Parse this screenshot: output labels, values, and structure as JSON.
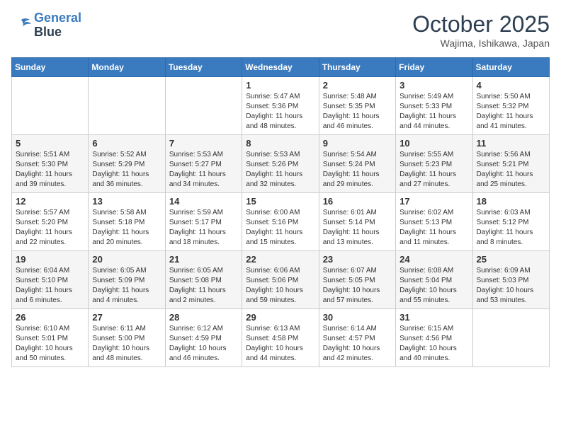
{
  "header": {
    "logo_line1": "General",
    "logo_line2": "Blue",
    "month_title": "October 2025",
    "location": "Wajima, Ishikawa, Japan"
  },
  "weekdays": [
    "Sunday",
    "Monday",
    "Tuesday",
    "Wednesday",
    "Thursday",
    "Friday",
    "Saturday"
  ],
  "weeks": [
    [
      {
        "day": "",
        "info": ""
      },
      {
        "day": "",
        "info": ""
      },
      {
        "day": "",
        "info": ""
      },
      {
        "day": "1",
        "info": "Sunrise: 5:47 AM\nSunset: 5:36 PM\nDaylight: 11 hours\nand 48 minutes."
      },
      {
        "day": "2",
        "info": "Sunrise: 5:48 AM\nSunset: 5:35 PM\nDaylight: 11 hours\nand 46 minutes."
      },
      {
        "day": "3",
        "info": "Sunrise: 5:49 AM\nSunset: 5:33 PM\nDaylight: 11 hours\nand 44 minutes."
      },
      {
        "day": "4",
        "info": "Sunrise: 5:50 AM\nSunset: 5:32 PM\nDaylight: 11 hours\nand 41 minutes."
      }
    ],
    [
      {
        "day": "5",
        "info": "Sunrise: 5:51 AM\nSunset: 5:30 PM\nDaylight: 11 hours\nand 39 minutes."
      },
      {
        "day": "6",
        "info": "Sunrise: 5:52 AM\nSunset: 5:29 PM\nDaylight: 11 hours\nand 36 minutes."
      },
      {
        "day": "7",
        "info": "Sunrise: 5:53 AM\nSunset: 5:27 PM\nDaylight: 11 hours\nand 34 minutes."
      },
      {
        "day": "8",
        "info": "Sunrise: 5:53 AM\nSunset: 5:26 PM\nDaylight: 11 hours\nand 32 minutes."
      },
      {
        "day": "9",
        "info": "Sunrise: 5:54 AM\nSunset: 5:24 PM\nDaylight: 11 hours\nand 29 minutes."
      },
      {
        "day": "10",
        "info": "Sunrise: 5:55 AM\nSunset: 5:23 PM\nDaylight: 11 hours\nand 27 minutes."
      },
      {
        "day": "11",
        "info": "Sunrise: 5:56 AM\nSunset: 5:21 PM\nDaylight: 11 hours\nand 25 minutes."
      }
    ],
    [
      {
        "day": "12",
        "info": "Sunrise: 5:57 AM\nSunset: 5:20 PM\nDaylight: 11 hours\nand 22 minutes."
      },
      {
        "day": "13",
        "info": "Sunrise: 5:58 AM\nSunset: 5:18 PM\nDaylight: 11 hours\nand 20 minutes."
      },
      {
        "day": "14",
        "info": "Sunrise: 5:59 AM\nSunset: 5:17 PM\nDaylight: 11 hours\nand 18 minutes."
      },
      {
        "day": "15",
        "info": "Sunrise: 6:00 AM\nSunset: 5:16 PM\nDaylight: 11 hours\nand 15 minutes."
      },
      {
        "day": "16",
        "info": "Sunrise: 6:01 AM\nSunset: 5:14 PM\nDaylight: 11 hours\nand 13 minutes."
      },
      {
        "day": "17",
        "info": "Sunrise: 6:02 AM\nSunset: 5:13 PM\nDaylight: 11 hours\nand 11 minutes."
      },
      {
        "day": "18",
        "info": "Sunrise: 6:03 AM\nSunset: 5:12 PM\nDaylight: 11 hours\nand 8 minutes."
      }
    ],
    [
      {
        "day": "19",
        "info": "Sunrise: 6:04 AM\nSunset: 5:10 PM\nDaylight: 11 hours\nand 6 minutes."
      },
      {
        "day": "20",
        "info": "Sunrise: 6:05 AM\nSunset: 5:09 PM\nDaylight: 11 hours\nand 4 minutes."
      },
      {
        "day": "21",
        "info": "Sunrise: 6:05 AM\nSunset: 5:08 PM\nDaylight: 11 hours\nand 2 minutes."
      },
      {
        "day": "22",
        "info": "Sunrise: 6:06 AM\nSunset: 5:06 PM\nDaylight: 10 hours\nand 59 minutes."
      },
      {
        "day": "23",
        "info": "Sunrise: 6:07 AM\nSunset: 5:05 PM\nDaylight: 10 hours\nand 57 minutes."
      },
      {
        "day": "24",
        "info": "Sunrise: 6:08 AM\nSunset: 5:04 PM\nDaylight: 10 hours\nand 55 minutes."
      },
      {
        "day": "25",
        "info": "Sunrise: 6:09 AM\nSunset: 5:03 PM\nDaylight: 10 hours\nand 53 minutes."
      }
    ],
    [
      {
        "day": "26",
        "info": "Sunrise: 6:10 AM\nSunset: 5:01 PM\nDaylight: 10 hours\nand 50 minutes."
      },
      {
        "day": "27",
        "info": "Sunrise: 6:11 AM\nSunset: 5:00 PM\nDaylight: 10 hours\nand 48 minutes."
      },
      {
        "day": "28",
        "info": "Sunrise: 6:12 AM\nSunset: 4:59 PM\nDaylight: 10 hours\nand 46 minutes."
      },
      {
        "day": "29",
        "info": "Sunrise: 6:13 AM\nSunset: 4:58 PM\nDaylight: 10 hours\nand 44 minutes."
      },
      {
        "day": "30",
        "info": "Sunrise: 6:14 AM\nSunset: 4:57 PM\nDaylight: 10 hours\nand 42 minutes."
      },
      {
        "day": "31",
        "info": "Sunrise: 6:15 AM\nSunset: 4:56 PM\nDaylight: 10 hours\nand 40 minutes."
      },
      {
        "day": "",
        "info": ""
      }
    ]
  ]
}
